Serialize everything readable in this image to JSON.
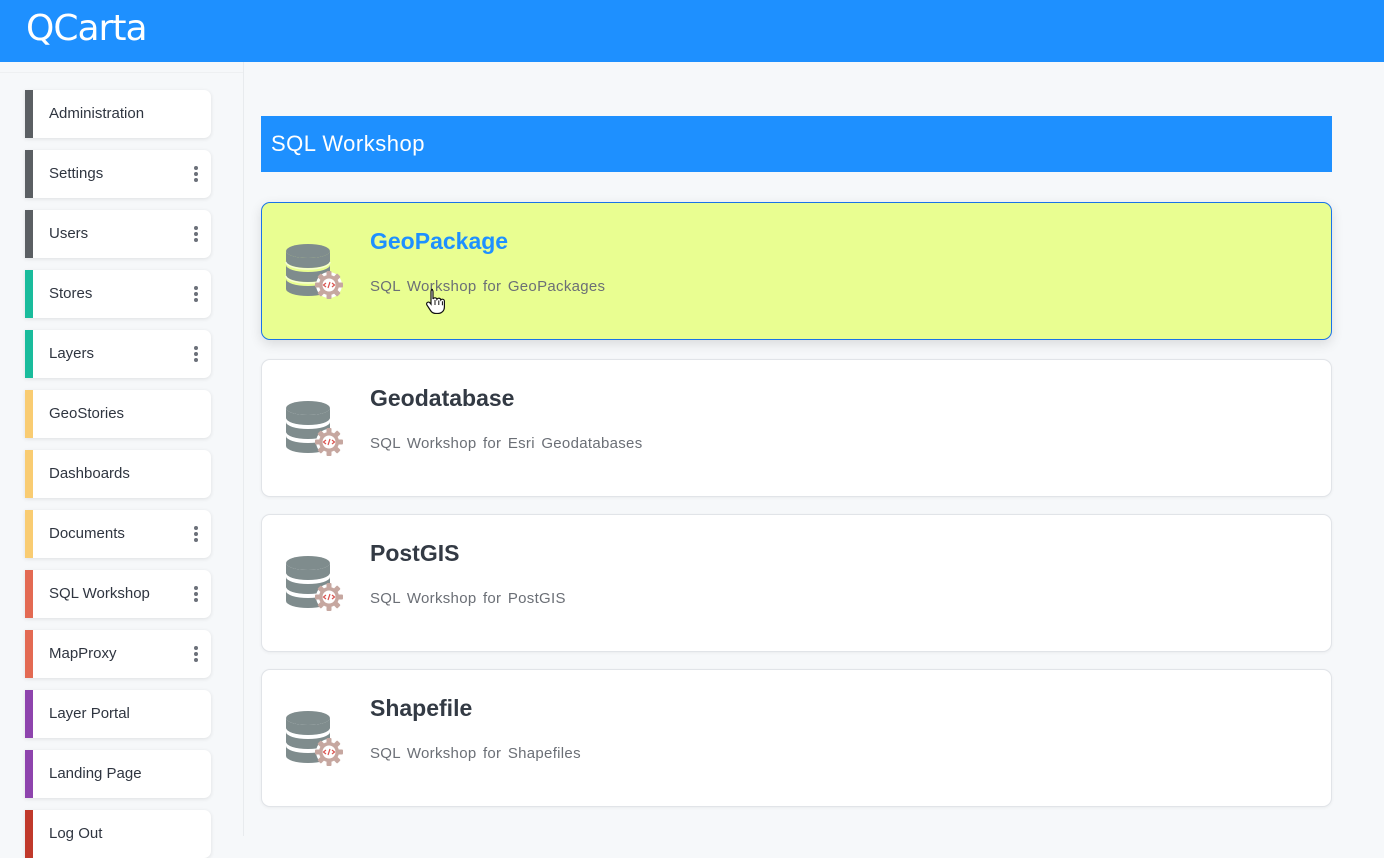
{
  "app": {
    "brand": "QCarta"
  },
  "sidebar": {
    "items": [
      {
        "label": "Administration",
        "color": "#5b5f63",
        "menu": false
      },
      {
        "label": "Settings",
        "color": "#5b5f63",
        "menu": true
      },
      {
        "label": "Users",
        "color": "#5b5f63",
        "menu": true
      },
      {
        "label": "Stores",
        "color": "#1abc9c",
        "menu": true
      },
      {
        "label": "Layers",
        "color": "#1abc9c",
        "menu": true
      },
      {
        "label": "GeoStories",
        "color": "#f9cc72",
        "menu": false
      },
      {
        "label": "Dashboards",
        "color": "#f9cc72",
        "menu": false
      },
      {
        "label": "Documents",
        "color": "#f9cc72",
        "menu": true
      },
      {
        "label": "SQL Workshop",
        "color": "#e36a53",
        "menu": true
      },
      {
        "label": "MapProxy",
        "color": "#e36a53",
        "menu": true
      },
      {
        "label": "Layer Portal",
        "color": "#8e44ad",
        "menu": false
      },
      {
        "label": "Landing Page",
        "color": "#8e44ad",
        "menu": false
      },
      {
        "label": "Log Out",
        "color": "#c0392b",
        "menu": false
      }
    ]
  },
  "main": {
    "title": "SQL Workshop",
    "cards": [
      {
        "title": "GeoPackage",
        "description": "SQL Workshop for GeoPackages",
        "icon": "database-gear-icon",
        "active": true
      },
      {
        "title": "Geodatabase",
        "description": "SQL Workshop for Esri Geodatabases",
        "icon": "database-gear-icon",
        "active": false
      },
      {
        "title": "PostGIS",
        "description": "SQL Workshop for PostGIS",
        "icon": "database-gear-icon",
        "active": false
      },
      {
        "title": "Shapefile",
        "description": "SQL Workshop for Shapefiles",
        "icon": "database-gear-icon",
        "active": false
      }
    ]
  },
  "colors": {
    "accent": "#1e90ff",
    "active_card_bg": "#e9fe91",
    "database_icon": "#7f8c8d",
    "gear_icon": "#c6a7a0"
  }
}
